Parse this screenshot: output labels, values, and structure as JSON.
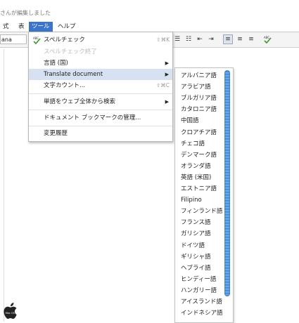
{
  "status": {
    "edited": "さんが編集しました"
  },
  "menubar": {
    "items": [
      "式",
      "表",
      "ツール",
      "ヘルプ"
    ]
  },
  "toolbar": {
    "font_value": "ana"
  },
  "tools_menu": {
    "items": [
      {
        "label": "スペルチェック",
        "shortcut": "⇧⌘K"
      },
      {
        "label": "スペルチェック終了"
      },
      {
        "label": "言語 (国)"
      },
      {
        "label": "Translate document"
      },
      {
        "label": "文字カウント...",
        "shortcut": "⇧⌘C"
      },
      {
        "label": "単語をウェブ全体から検索"
      },
      {
        "label": "ドキュメント ブックマークの管理..."
      },
      {
        "label": "変更履歴"
      }
    ]
  },
  "languages": [
    "アルバニア語",
    "アラビア語",
    "ブルガリア語",
    "カタロニア語",
    "中国語",
    "クロアチア語",
    "チェコ語",
    "デンマーク語",
    "オランダ語",
    "英語 (米国)",
    "エストニア語",
    "Filipino",
    "フィンランド語",
    "フランス語",
    "ガリシア語",
    "ドイツ語",
    "ギリシャ語",
    "ヘブライ語",
    "ヒンディー語",
    "ハンガリー語",
    "アイスランド語",
    "インドネシア語"
  ],
  "logo": {
    "text": "Mac OS X"
  },
  "colors": {
    "accent": "#3b74c9",
    "highlight": "#d6e2f2",
    "scrollbar": "#3a86d6"
  }
}
